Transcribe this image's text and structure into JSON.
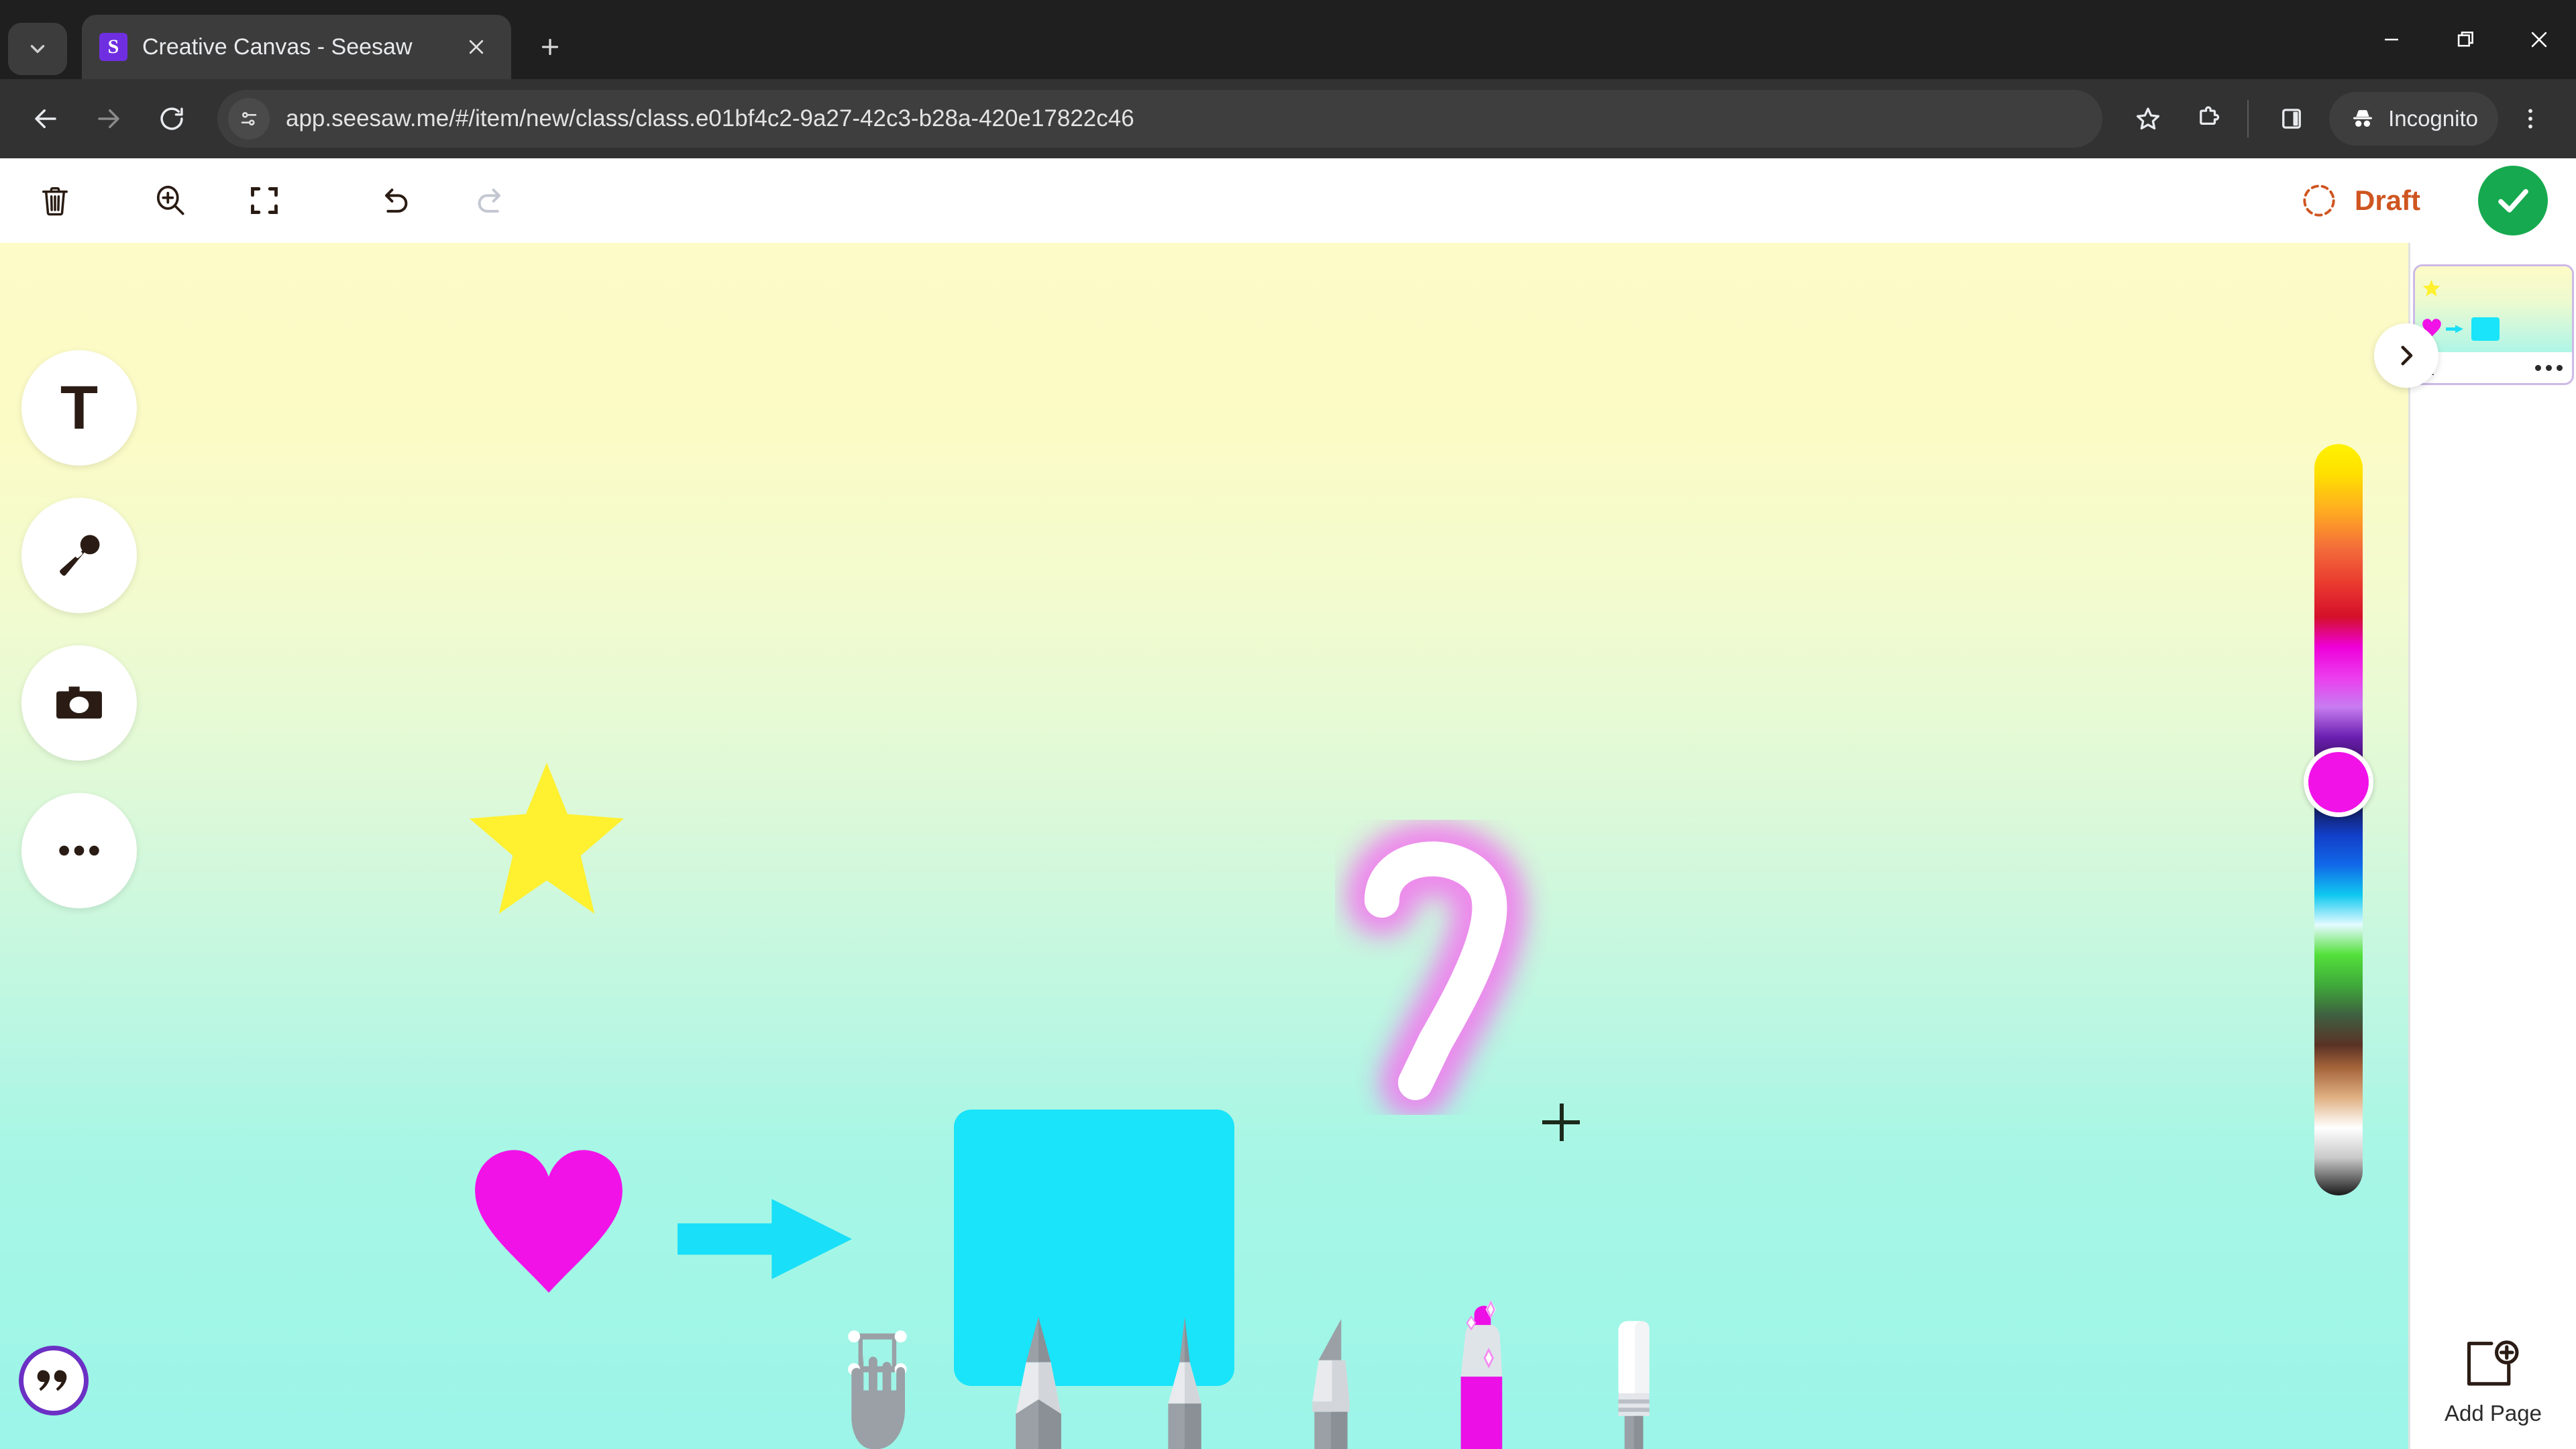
{
  "browser": {
    "tab_search_icon": "chevron-down-icon",
    "tab": {
      "favicon_letter": "S",
      "title": "Creative Canvas - Seesaw",
      "close_icon": "close-icon"
    },
    "new_tab_icon": "plus-icon",
    "window_controls": {
      "minimize": "minimize-icon",
      "maximize": "restore-icon",
      "close": "close-icon"
    },
    "nav": {
      "back": "back-arrow-icon",
      "forward": "forward-arrow-icon",
      "reload": "reload-icon"
    },
    "omnibox": {
      "site_settings_icon": "tune-icon",
      "url": "app.seesaw.me/#/item/new/class/class.e01bf4c2-9a27-42c3-b28a-420e17822c46"
    },
    "actions": {
      "bookmark": "star-icon",
      "extensions": "extensions-icon",
      "side_panel": "side-panel-icon",
      "incognito_label": "Incognito",
      "incognito_icon": "incognito-icon",
      "menu": "more-vertical-icon"
    }
  },
  "app": {
    "toolbar": {
      "delete_icon": "trash-icon",
      "zoom_in_icon": "zoom-in-icon",
      "fit_screen_icon": "fit-screen-icon",
      "undo_icon": "undo-icon",
      "redo_icon": "redo-icon",
      "status_icon": "draft-check-icon",
      "status_label": "Draft",
      "status_color": "#CF5520",
      "done_icon": "check-icon",
      "done_color": "#16A94F"
    },
    "left_rail": [
      {
        "name": "text-tool",
        "letter": "T",
        "icon": "text-icon"
      },
      {
        "name": "audio-tool",
        "icon": "microphone-icon"
      },
      {
        "name": "photo-tool",
        "icon": "camera-icon"
      },
      {
        "name": "more-tool",
        "icon": "more-horizontal-icon"
      }
    ],
    "comment_button": {
      "icon": "quote-icon",
      "ring_color": "#6B30C4"
    },
    "pen_tray": [
      {
        "name": "move-tool",
        "icon": "hand-select-icon",
        "active": false
      },
      {
        "name": "pencil-tool",
        "icon": "pencil-icon",
        "active": false
      },
      {
        "name": "pen-tool",
        "icon": "pen-icon",
        "active": false
      },
      {
        "name": "marker-tool",
        "icon": "marker-icon",
        "active": false
      },
      {
        "name": "highlighter-tool",
        "icon": "highlighter-icon",
        "active": true
      },
      {
        "name": "eraser-tool",
        "icon": "eraser-icon",
        "active": false
      }
    ],
    "color_picker": {
      "selected_color": "#F112E8",
      "icon": "color-spectrum-slider"
    },
    "canvas": {
      "background_top": "#FDFBC7",
      "background_bottom": "#9BF5E8",
      "cursor_icon": "crosshair-cursor",
      "shapes": [
        {
          "name": "star-sticker",
          "type": "star",
          "color": "#FFF030"
        },
        {
          "name": "heart-sticker",
          "type": "heart",
          "color": "#F112E8"
        },
        {
          "name": "arrow-sticker",
          "type": "arrow",
          "color": "#19DFF8"
        },
        {
          "name": "square-sticker",
          "type": "rect",
          "color": "#19E4FA"
        },
        {
          "name": "highlighter-stroke",
          "type": "stroke",
          "color": "#FFFFFF",
          "glow": "#F17CEE"
        }
      ]
    },
    "pages_panel": {
      "collapse_icon": "chevron-right-icon",
      "pages": [
        {
          "number": "1",
          "menu_icon": "more-horizontal-icon"
        }
      ],
      "add_page": {
        "icon": "add-page-icon",
        "label": "Add Page"
      }
    }
  }
}
